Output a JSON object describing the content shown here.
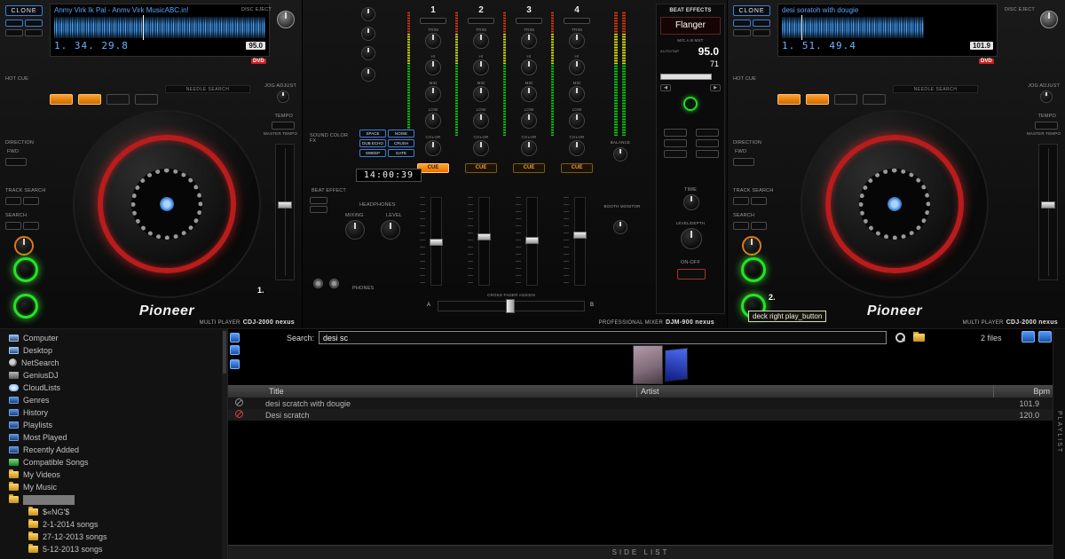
{
  "tooltip": "deck right play_button",
  "decks": {
    "left": {
      "number": "1.",
      "clone": "CLONE",
      "disc_eject": "DISC EJECT",
      "hot_cue": "HOT CUE",
      "needle_search": "NEEDLE SEARCH",
      "direction": "DIRECTION",
      "fwd": "FWD",
      "track_search": "TRACK SEARCH",
      "search": "SEARCH",
      "jog_adjust": "JOG ADJUST",
      "tempo": "TEMPO",
      "master_tempo": "MASTER TEMPO",
      "brand": "Pioneer",
      "unit_type": "MULTI PLAYER",
      "unit_model": "CDJ-2000 nexus",
      "screen": {
        "track_title": "Anmy Virk Ik Pal - Anmv Virk MusicABC.in!",
        "time": "1. 34. 29.8",
        "bpm": "95.0",
        "badge": "DVD"
      }
    },
    "right": {
      "number": "2.",
      "clone": "CLONE",
      "disc_eject": "DISC EJECT",
      "hot_cue": "HOT CUE",
      "needle_search": "NEEDLE SEARCH",
      "direction": "DIRECTION",
      "fwd": "FWD",
      "track_search": "TRACK SEARCH",
      "search": "SEARCH",
      "jog_adjust": "JOG ADJUST",
      "tempo": "TEMPO",
      "master_tempo": "MASTER TEMPO",
      "brand": "Pioneer",
      "unit_type": "MULTI PLAYER",
      "unit_model": "CDJ-2000 nexus",
      "screen": {
        "track_title": "desi soratoh with dougie",
        "time": "1. 51. 49.4",
        "bpm": "101.9",
        "badge": "DVD"
      }
    }
  },
  "mixer": {
    "clock": "14:00:39",
    "sound_color_fx": "SOUND COLOR FX",
    "fx_buttons": [
      "SPACE",
      "DUB ECHO",
      "SWEEP",
      "NOISE",
      "CRUSH",
      "GATE"
    ],
    "beat_effect": "BEAT EFFECT",
    "headphones": "HEADPHONES",
    "mixing": "MIXING",
    "level": "LEVEL",
    "phones": "PHONES",
    "balance": "BALANCE",
    "booth_monitor": "BOOTH MONITOR",
    "cross_fader_assign": "CROSS FADER ASSIGN",
    "xfader_a": "A",
    "xfader_b": "B",
    "unit_type": "PROFESSIONAL MIXER",
    "unit_model": "DJM-900 nexus",
    "knob_labels": [
      "TRIM",
      "HI",
      "MID",
      "LOW",
      "COLOR"
    ],
    "cue_label": "CUE",
    "channels": [
      {
        "number": "1"
      },
      {
        "number": "2"
      },
      {
        "number": "3"
      },
      {
        "number": "4"
      }
    ],
    "beat_fx": {
      "title": "BEAT EFFECTS",
      "effect": "Flanger",
      "assign": "M/C  A  B  MST",
      "auto_tap": "AUTO/TAP",
      "bpm": "95.0",
      "percent": "71",
      "beat_left": "◀",
      "beat_right": "▶",
      "time": "TIME",
      "level_depth": "LEVEL/DEPTH",
      "on_off": "ON-OFF"
    }
  },
  "browser": {
    "search_label": "Search:",
    "search_value": "desi sc",
    "files_count": "2 files",
    "sidebar": [
      {
        "label": "Computer"
      },
      {
        "label": "Desktop"
      },
      {
        "label": "NetSearch"
      },
      {
        "label": "GeniusDJ"
      },
      {
        "label": "CloudLists"
      },
      {
        "label": "Genres"
      },
      {
        "label": "History"
      },
      {
        "label": "Playlists"
      },
      {
        "label": "Most Played"
      },
      {
        "label": "Recently Added"
      },
      {
        "label": "Compatible Songs"
      },
      {
        "label": "My Videos"
      },
      {
        "label": "My Music"
      },
      {
        "label": ""
      },
      {
        "label": "$«NG'$"
      },
      {
        "label": "2-1-2014 songs"
      },
      {
        "label": "27-12-2013 songs"
      },
      {
        "label": "5-12-2013 songs"
      }
    ],
    "table": {
      "headers": {
        "title": "Title",
        "artist": "Artist",
        "bpm": "Bpm"
      },
      "rows": [
        {
          "title": "desi scratch with dougie",
          "artist": "",
          "bpm": "101.9"
        },
        {
          "title": "Desi scratch",
          "artist": "",
          "bpm": "120.0"
        }
      ]
    },
    "side_list": "SIDE LIST",
    "playlist_vertical": "PLAYLIST"
  }
}
